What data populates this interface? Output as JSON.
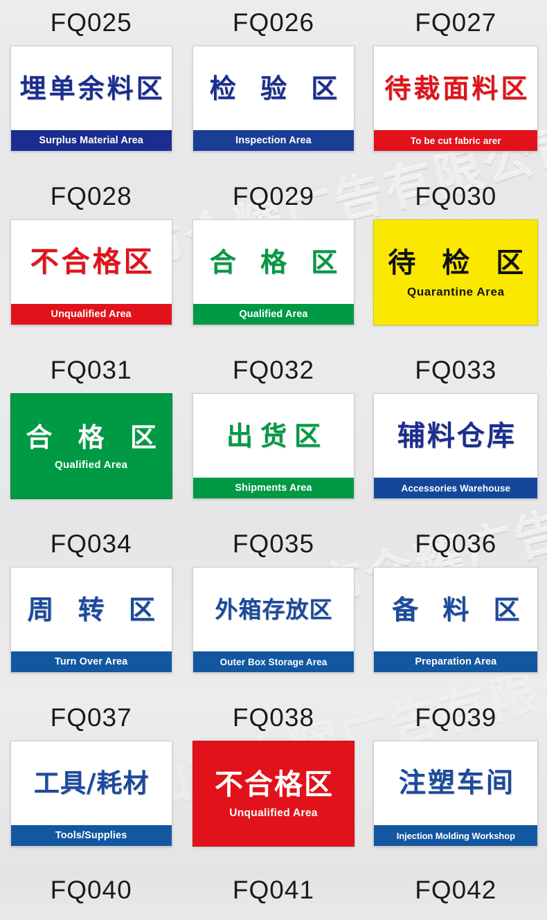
{
  "page": {
    "background_color": "#e9e9e9",
    "watermark_text": "佛山市众耀广告有限公司",
    "columns": 3,
    "rows": 6
  },
  "palette": {
    "navy": "#1b2d8f",
    "blue": "#14549b",
    "green": "#009944",
    "red": "#e2121a",
    "yellow": "#fae800",
    "black": "#111111",
    "white": "#ffffff"
  },
  "signs": [
    {
      "code": "FQ025",
      "cn": "埋单余料区",
      "en": "Surplus Material  Area",
      "style": "band",
      "cn_color": "#1b2d8f",
      "band_color": "#1b2d8f",
      "band_text_color": "#ffffff",
      "plate_color": "#ffffff"
    },
    {
      "code": "FQ026",
      "cn": "检 验 区",
      "en": "Inspection  Area",
      "style": "band",
      "cn_color": "#1b2d8f",
      "band_color": "#1a3d96",
      "band_text_color": "#ffffff",
      "plate_color": "#ffffff"
    },
    {
      "code": "FQ027",
      "cn": "待裁面料区",
      "en": "To be cut fabric arer",
      "style": "band",
      "cn_color": "#e2121a",
      "band_color": "#e2121a",
      "band_text_color": "#ffffff",
      "plate_color": "#ffffff"
    },
    {
      "code": "FQ028",
      "cn": "不合格区",
      "en": "Unqualified  Area",
      "style": "band",
      "cn_color": "#e2121a",
      "band_color": "#e2121a",
      "band_text_color": "#ffffff",
      "plate_color": "#ffffff"
    },
    {
      "code": "FQ029",
      "cn": "合 格 区",
      "en": "Qualified  Area",
      "style": "band",
      "cn_color": "#009944",
      "band_color": "#009944",
      "band_text_color": "#ffffff",
      "plate_color": "#ffffff"
    },
    {
      "code": "FQ030",
      "cn": "待 检 区",
      "en": "Quarantine  Area",
      "style": "solid-yellow",
      "cn_color": "#111111",
      "band_color": "#fae800",
      "band_text_color": "#111111",
      "plate_color": "#fae800"
    },
    {
      "code": "FQ031",
      "cn": "合 格 区",
      "en": "Qualified   Area",
      "style": "solid-green",
      "cn_color": "#ffffff",
      "band_color": "#009944",
      "band_text_color": "#ffffff",
      "plate_color": "#009944"
    },
    {
      "code": "FQ032",
      "cn": "出货区",
      "en": "Shipments  Area",
      "style": "band",
      "cn_color": "#009944",
      "band_color": "#009944",
      "band_text_color": "#ffffff",
      "plate_color": "#ffffff"
    },
    {
      "code": "FQ033",
      "cn": "辅料仓库",
      "en": "Accessories Warehouse",
      "style": "band",
      "cn_color": "#1b2d8f",
      "band_color": "#14479b",
      "band_text_color": "#ffffff",
      "plate_color": "#ffffff"
    },
    {
      "code": "FQ034",
      "cn": "周 转 区",
      "en": "Turn Over Area",
      "style": "band",
      "cn_color": "#1b4a9e",
      "band_color": "#1257a0",
      "band_text_color": "#ffffff",
      "plate_color": "#ffffff"
    },
    {
      "code": "FQ035",
      "cn": "外箱存放区",
      "en": "Outer Box Storage Area",
      "style": "band",
      "cn_color": "#1b4a9e",
      "band_color": "#1257a0",
      "band_text_color": "#ffffff",
      "plate_color": "#ffffff"
    },
    {
      "code": "FQ036",
      "cn": "备 料 区",
      "en": "Preparation  Area",
      "style": "band",
      "cn_color": "#1b4a9e",
      "band_color": "#1257a0",
      "band_text_color": "#ffffff",
      "plate_color": "#ffffff"
    },
    {
      "code": "FQ037",
      "cn": "工具/耗材",
      "en": "Tools/Supplies",
      "style": "band",
      "cn_color": "#1b4a9e",
      "band_color": "#1257a0",
      "band_text_color": "#ffffff",
      "plate_color": "#ffffff"
    },
    {
      "code": "FQ038",
      "cn": "不合格区",
      "en": "Unqualified Area",
      "style": "solid-red",
      "cn_color": "#ffffff",
      "band_color": "#e2121a",
      "band_text_color": "#ffffff",
      "plate_color": "#e2121a"
    },
    {
      "code": "FQ039",
      "cn": "注塑车间",
      "en": "Injection Molding Workshop",
      "style": "band",
      "cn_color": "#1b4a9e",
      "band_color": "#1257a0",
      "band_text_color": "#ffffff",
      "plate_color": "#ffffff"
    }
  ],
  "bottom_codes": [
    "FQ040",
    "FQ041",
    "FQ042"
  ]
}
